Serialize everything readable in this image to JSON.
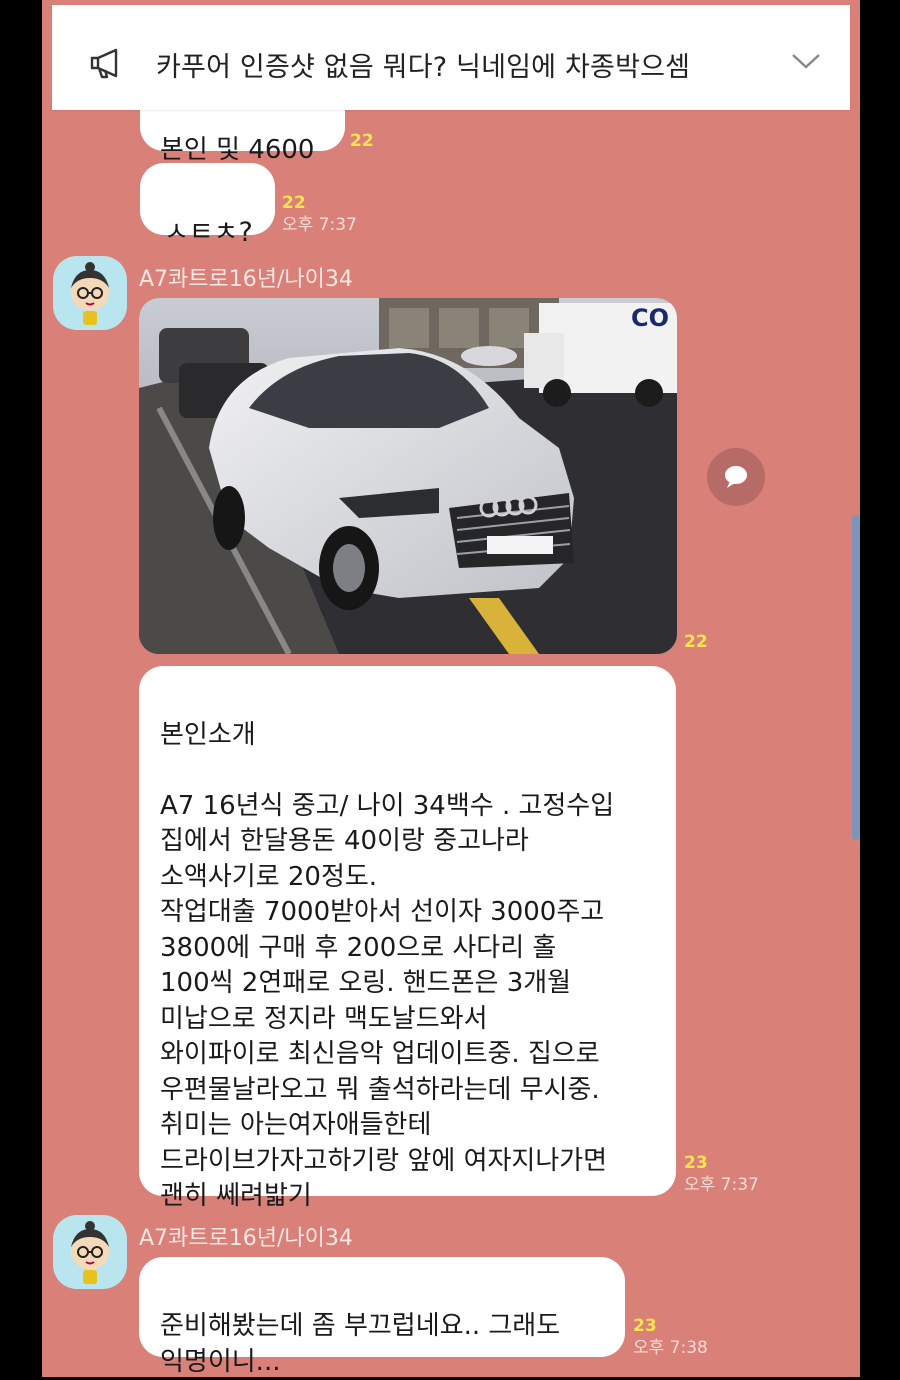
{
  "notice": {
    "icon": "megaphone-icon",
    "text": "카푸어 인증샷 없음 뭐다? 닉네임에 차종박으셈",
    "expand_icon": "chevron-down-icon"
  },
  "messages": [
    {
      "text": "본인 및 4600",
      "unread": "22"
    },
    {
      "text": "ㅅㅌㅊ?",
      "unread": "22",
      "time": "오후 7:37"
    },
    {
      "sender": "A7콰트로16년/나이34",
      "unread": "22"
    },
    {
      "text": "본인소개\n\nA7 16년식 중고/ 나이 34백수 . 고정수입\n집에서 한달용돈 40이랑 중고나라\n소액사기로 20정도.\n작업대출 7000받아서 선이자 3000주고\n3800에 구매 후 200으로 사다리 홀\n100씩 2연패로 오링. 핸드폰은 3개월\n미납으로 정지라 맥도날드와서\n와이파이로 최신음악 업데이트중. 집으로\n우편물날라오고 뭐 출석하라는데 무시중.\n취미는 아는여자애들한테\n드라이브가자고하기랑 앞에 여자지나가면\n괜히 쎄려밟기",
      "unread": "23",
      "time": "오후 7:37"
    },
    {
      "sender": "A7콰트로16년/나이34",
      "text": "준비해봤는데 좀 부끄럽네요.. 그래도\n익명이니...",
      "unread": "23",
      "time": "오후 7:38"
    }
  ],
  "photo": {
    "truck_text": "CO"
  },
  "colors": {
    "chat_bg": "#d98079",
    "unread": "#ffe44d"
  }
}
